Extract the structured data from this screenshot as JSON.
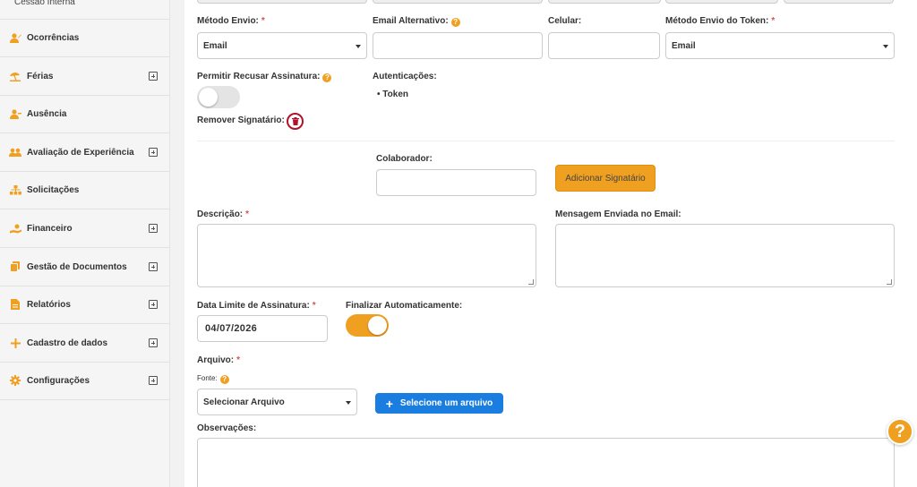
{
  "sidebar": {
    "top_item": "Cessão Interna",
    "items": [
      {
        "label": "Ocorrências",
        "icon": "user-pen-icon",
        "expandable": false
      },
      {
        "label": "Férias",
        "icon": "beach-umbrella-icon",
        "expandable": true
      },
      {
        "label": "Ausência",
        "icon": "user-minus-icon",
        "expandable": false
      },
      {
        "label": "Avaliação de Experiência",
        "icon": "users-icon",
        "expandable": true
      },
      {
        "label": "Solicitações",
        "icon": "sitemap-icon",
        "expandable": false
      },
      {
        "label": "Financeiro",
        "icon": "hand-money-icon",
        "expandable": true
      },
      {
        "label": "Gestão de Documentos",
        "icon": "documents-icon",
        "expandable": true
      },
      {
        "label": "Relatórios",
        "icon": "file-icon",
        "expandable": true
      },
      {
        "label": "Cadastro de dados",
        "icon": "plus-icon",
        "expandable": true
      },
      {
        "label": "Configurações",
        "icon": "gear-icon",
        "expandable": true
      }
    ],
    "icon_color": "#f0a020"
  },
  "form": {
    "metodo_envio": {
      "label": "Método Envio:",
      "value": "Email"
    },
    "email_alternativo": {
      "label": "Email Alternativo:",
      "value": ""
    },
    "celular": {
      "label": "Celular:",
      "value": ""
    },
    "metodo_token": {
      "label": "Método Envio do Token:",
      "value": "Email"
    },
    "permitir_recusar": {
      "label": "Permitir Recusar Assinatura:",
      "on": false
    },
    "autenticacoes": {
      "label": "Autenticações:",
      "items": [
        "Token"
      ]
    },
    "remover_signatario": {
      "label": "Remover Signatário:"
    },
    "colaborador": {
      "label": "Colaborador:",
      "value": ""
    },
    "adicionar_signatario": "Adicionar Signatário",
    "descricao": {
      "label": "Descrição:",
      "value": ""
    },
    "mensagem_email": {
      "label": "Mensagem Enviada no Email:",
      "value": ""
    },
    "data_limite": {
      "label": "Data Limite de Assinatura:",
      "value": "04/07/2026"
    },
    "finalizar_auto": {
      "label": "Finalizar Automaticamente:",
      "on": true
    },
    "arquivo": {
      "label": "Arquivo:"
    },
    "fonte": {
      "label": "Fonte:",
      "value": "Selecionar Arquivo"
    },
    "selecione_arquivo": "Selecione um arquivo",
    "observacoes": {
      "label": "Observações:",
      "value": ""
    },
    "required_mark": "*",
    "help_mark": "?"
  },
  "help_button": "?",
  "colors": {
    "accent": "#f0a020",
    "primary": "#1a7ee0",
    "danger": "#b0122a",
    "required": "#d9534f"
  }
}
